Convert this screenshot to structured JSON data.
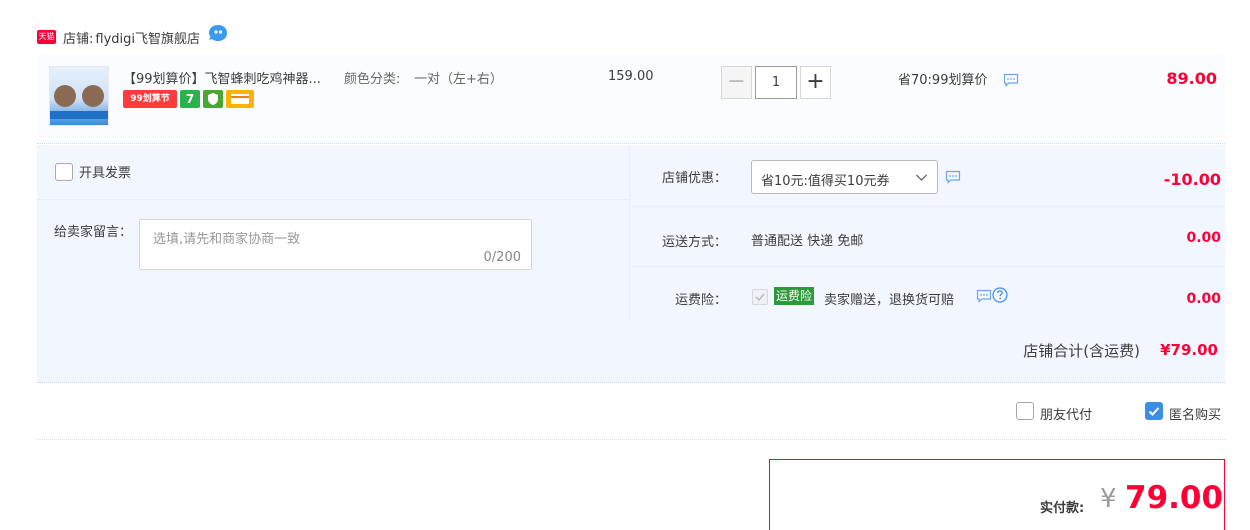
{
  "shop": {
    "badge": "天猫",
    "prefix": "店铺:",
    "name": "flydigi飞智旗舰店"
  },
  "item": {
    "title": "【99划算价】飞智蜂刺吃鸡神器...",
    "sku_label": "颜色分类:",
    "sku_value": "一对（左+右）",
    "badges": {
      "festival": "99划算节",
      "seven_day": "7"
    },
    "unit_price": "159.00",
    "quantity": "1",
    "discount_text": "省70:99划算价",
    "total": "89.00"
  },
  "options": {
    "invoice_label": "开具发票",
    "message_label": "给卖家留言：",
    "message_placeholder": "选填,请先和商家协商一致",
    "message_count": "0/200",
    "coupon_label": "店铺优惠：",
    "coupon_value": "省10元:值得买10元券",
    "coupon_amount": "-10.00",
    "shipping_label": "运送方式：",
    "shipping_value": "普通配送 快递 免邮",
    "shipping_amount": "0.00",
    "insurance_label": "运费险：",
    "insurance_badge": "运费险",
    "insurance_text": "卖家赠送，退换货可赔",
    "insurance_amount": "0.00"
  },
  "store_total": {
    "label": "店铺合计(含运费)",
    "value": "¥79.00"
  },
  "extras": {
    "friend_pay": "朋友代付",
    "anonymous": "匿名购买",
    "anonymous_checked": true
  },
  "payment": {
    "label": "实付款:",
    "currency": "¥",
    "amount": "79.00"
  },
  "colors": {
    "accent_red": "#ff0036",
    "panel_blue": "#f2f7ff",
    "checkbox_blue": "#3c8ee4",
    "insurance_green": "#2a9a3a"
  }
}
